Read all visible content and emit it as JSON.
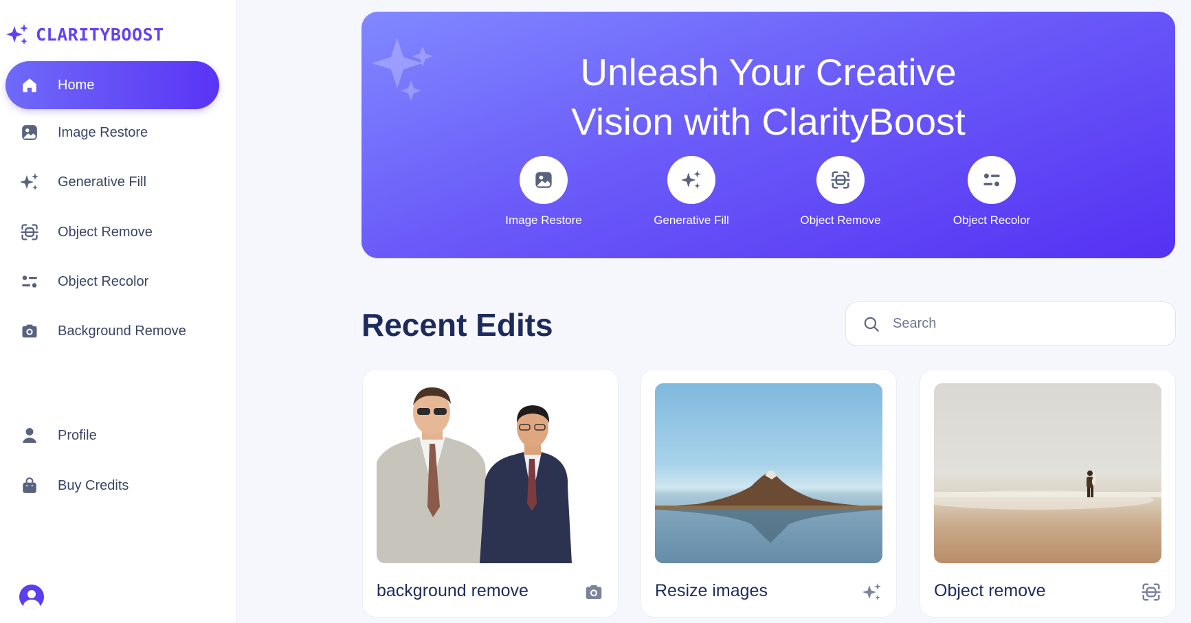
{
  "brand": {
    "name": "CLARITYBOOST",
    "accent": "#6340f5"
  },
  "sidebar": {
    "items": [
      {
        "label": "Home",
        "icon": "home-icon",
        "active": true
      },
      {
        "label": "Image Restore",
        "icon": "image-icon",
        "active": false
      },
      {
        "label": "Generative Fill",
        "icon": "sparkles-icon",
        "active": false
      },
      {
        "label": "Object Remove",
        "icon": "scan-remove-icon",
        "active": false
      },
      {
        "label": "Object Recolor",
        "icon": "recolor-icon",
        "active": false
      },
      {
        "label": "Background Remove",
        "icon": "camera-icon",
        "active": false
      }
    ],
    "bottom_items": [
      {
        "label": "Profile",
        "icon": "user-icon"
      },
      {
        "label": "Buy Credits",
        "icon": "bag-icon"
      }
    ]
  },
  "hero": {
    "title_line1": "Unleash Your Creative",
    "title_line2": "Vision with ClarityBoost",
    "actions": [
      {
        "label": "Image Restore",
        "icon": "image-icon"
      },
      {
        "label": "Generative Fill",
        "icon": "sparkles-icon"
      },
      {
        "label": "Object Remove",
        "icon": "scan-remove-icon"
      },
      {
        "label": "Object Recolor",
        "icon": "recolor-icon"
      }
    ]
  },
  "recent": {
    "title": "Recent Edits",
    "search_placeholder": "Search",
    "cards": [
      {
        "label": "background remove",
        "icon": "camera-icon",
        "image": "two men in suits, background removed"
      },
      {
        "label": "Resize images",
        "icon": "sparkles-icon",
        "image": "mountain reflected in lake"
      },
      {
        "label": "Object remove",
        "icon": "scan-remove-icon",
        "image": "surfer on beach"
      }
    ]
  }
}
